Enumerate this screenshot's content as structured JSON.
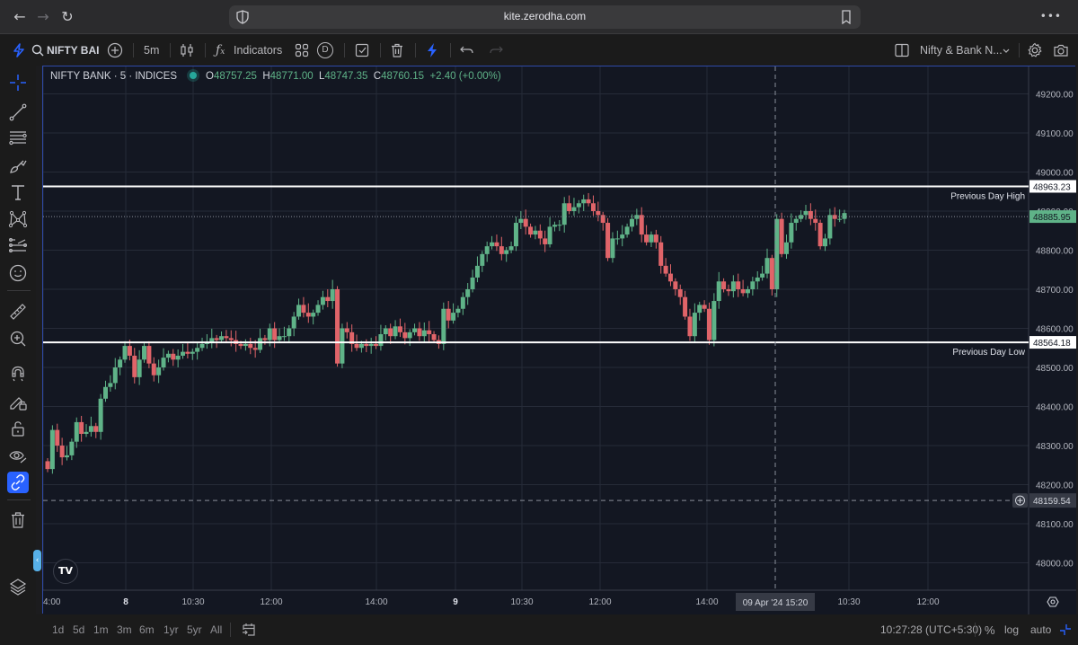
{
  "browser": {
    "url": "kite.zerodha.com",
    "back": "←",
    "forward": "→",
    "reload": "↻",
    "more": "•••"
  },
  "toolbar": {
    "symbol": "NIFTY BAI",
    "interval": "5m",
    "indicators_label": "Indicators",
    "template_badge": "D",
    "layout_name": "Nifty & Bank N...",
    "colors": {
      "lightning": "#2962ff",
      "accent": "#2962ff"
    }
  },
  "left_tools": [
    {
      "name": "crosshair-icon",
      "active": false
    },
    {
      "name": "trend-line-icon",
      "active": false
    },
    {
      "name": "fib-retracement-icon",
      "active": false
    },
    {
      "name": "brush-icon",
      "active": false
    },
    {
      "name": "text-icon",
      "active": false
    },
    {
      "name": "pattern-icon",
      "active": false
    },
    {
      "name": "prediction-icon",
      "active": false
    },
    {
      "name": "emoji-icon",
      "active": false
    },
    {
      "name": "ruler-icon",
      "active": false
    },
    {
      "name": "zoom-in-icon",
      "active": false
    },
    {
      "name": "magnet-icon",
      "active": false
    },
    {
      "name": "lock-drawing-icon",
      "active": false
    },
    {
      "name": "unlock-icon",
      "active": false
    },
    {
      "name": "eye-icon",
      "active": false
    },
    {
      "name": "link-icon",
      "active": true
    },
    {
      "name": "trash-icon",
      "active": false
    },
    {
      "name": "layers-icon",
      "active": false
    }
  ],
  "legend": {
    "title": "NIFTY BANK · 5 · INDICES",
    "o_label": "O",
    "o": "48757.25",
    "h_label": "H",
    "h": "48771.00",
    "l_label": "L",
    "l": "48747.35",
    "c_label": "C",
    "c": "48760.15",
    "change": "+2.40 (+0.00%)"
  },
  "chart_data": {
    "type": "candlestick",
    "title": "NIFTY BANK · 5 · INDICES",
    "ylim": [
      47930,
      49270
    ],
    "y_ticks": [
      48000,
      48100,
      48200,
      48300,
      48400,
      48500,
      48600,
      48700,
      48800,
      48900,
      49000,
      49100,
      49200
    ],
    "y_tick_labels": [
      "48000.00",
      "48100.00",
      "48200.00",
      "48300.00",
      "48400.00",
      "48500.00",
      "48600.00",
      "48700.00",
      "48800.00",
      "48900.00",
      "49000.00",
      "49100.00",
      "49200.00"
    ],
    "x_ticks": [
      {
        "slot": 0,
        "label": "4:00"
      },
      {
        "slot": 13,
        "label": "8"
      },
      {
        "slot": 31,
        "label": "10:30"
      },
      {
        "slot": 49,
        "label": "12:00"
      },
      {
        "slot": 73,
        "label": "14:00"
      },
      {
        "slot": 86,
        "label": "9"
      },
      {
        "slot": 104,
        "label": "10:30"
      },
      {
        "slot": 122,
        "label": "12:00"
      },
      {
        "slot": 146,
        "label": "14:00"
      },
      {
        "slot": 177,
        "label": "10:30"
      },
      {
        "slot": 195,
        "label": "12:00"
      }
    ],
    "slot_count": 204,
    "horizontal_lines": [
      {
        "label": "Previous Day High",
        "value": 48963.23,
        "value_label": "48963.23",
        "color": "#ffffff"
      },
      {
        "label": "Previous Day Low",
        "value": 48564.18,
        "value_label": "48564.18",
        "color": "#ffffff"
      }
    ],
    "last_price": {
      "value": 48885.95,
      "label": "48885.95",
      "color": "#5fb388"
    },
    "crosshair": {
      "price": 48159.54,
      "price_label": "48159.54",
      "time_label": "09 Apr '24   15:20",
      "slot": 163
    },
    "candles": []
  },
  "bottom": {
    "ranges": [
      "1d",
      "5d",
      "1m",
      "3m",
      "6m",
      "1yr",
      "5yr",
      "All"
    ],
    "clock": "10:27:28 (UTC+5:30)",
    "percent": "%",
    "log": "log",
    "auto": "auto"
  },
  "colors": {
    "up": "#5fb388",
    "down": "#e06469",
    "background": "#131722",
    "grid": "#262b38"
  }
}
